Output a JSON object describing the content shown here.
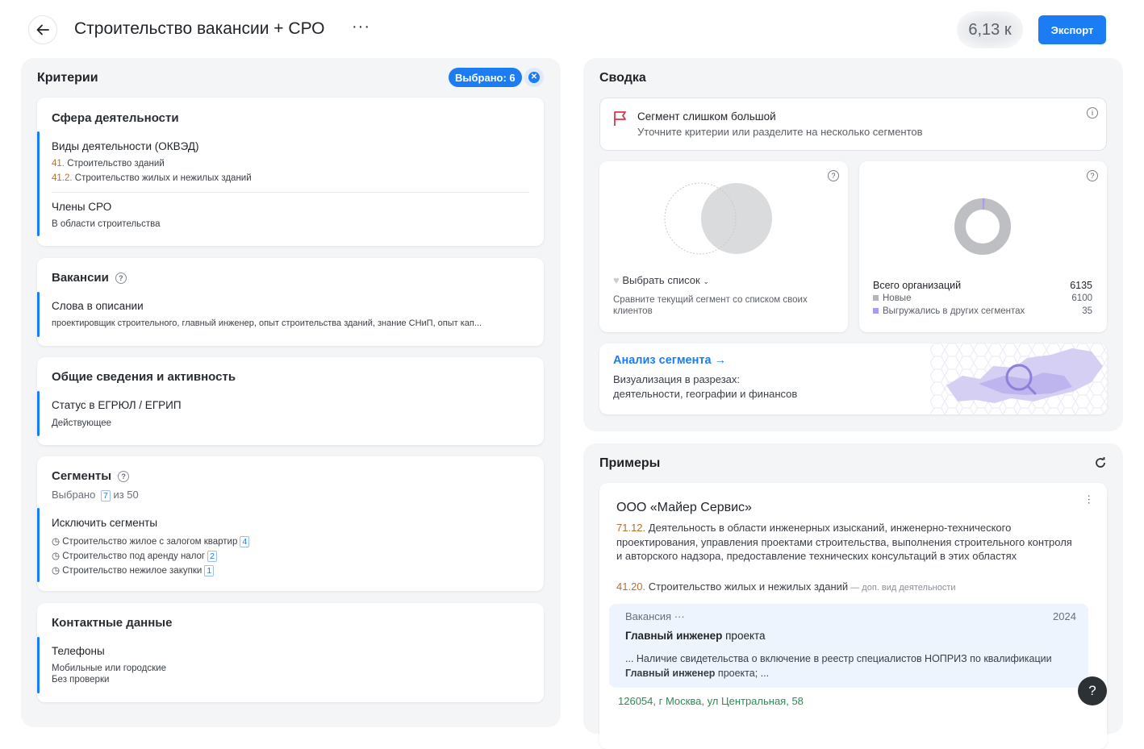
{
  "header": {
    "title": "Строительство вакансии + СРО",
    "more": "···",
    "count": "6,13 к",
    "export_label": "Экспорт"
  },
  "criteria": {
    "title": "Критерии",
    "selected_badge": "Выбрано: 6",
    "activity": {
      "title": "Сфера деятельности",
      "okved_title": "Виды деятельности (ОКВЭД)",
      "okved_items": [
        {
          "code": "41.",
          "text": " Строительство зданий"
        },
        {
          "code": "41.2.",
          "text": " Строительство жилых и нежилых зданий"
        }
      ],
      "sro_title": "Члены СРО",
      "sro_value": "В области строительства"
    },
    "vacancies": {
      "title": "Вакансии",
      "words_title": "Слова в описании",
      "words_value": "проектировщик строительного, главный инженер, опыт строительства зданий, знание СНиП, опыт кап..."
    },
    "general": {
      "title": "Общие сведения и активность",
      "status_title": "Статус в ЕГРЮЛ / ЕГРИП",
      "status_value": "Действующее"
    },
    "segments": {
      "title": "Сегменты",
      "selected_prefix": "Выбрано",
      "selected_count": "7",
      "selected_suffix": "из 50",
      "exclude_title": "Исключить сегменты",
      "items": [
        {
          "label": "Строительство жилое с залогом квартир",
          "count": "4"
        },
        {
          "label": "Строительство под аренду налог",
          "count": "2"
        },
        {
          "label": "Строительство нежилое закупки",
          "count": "1"
        }
      ]
    },
    "contacts": {
      "title": "Контактные данные",
      "phones_title": "Телефоны",
      "phones_line1": "Мобильные или городские",
      "phones_line2": "Без проверки"
    }
  },
  "summary": {
    "title": "Сводка",
    "warning_title": "Сегмент слишком большой",
    "warning_text": "Уточните критерии или разделите на несколько сегментов",
    "compare_label": "Выбрать список",
    "compare_hint": "Сравните текущий сегмент со списком своих клиентов",
    "orgs": [
      {
        "label": "Всего организаций",
        "value": "6135"
      },
      {
        "label": "Новые",
        "value": "6100",
        "color": "#b4b6b9"
      },
      {
        "label": "Выгружались в других сегментах",
        "value": "35",
        "color": "#a99cf0"
      }
    ],
    "analysis_title": "Анализ сегмента",
    "analysis_text1": "Визуализация в разрезах:",
    "analysis_text2": "деятельности, географии и финансов"
  },
  "examples": {
    "title": "Примеры",
    "company": "ООО «Майер Сервис»",
    "main_okved_code": "71.12.",
    "main_okved_text": " Деятельность в области инженерных изысканий, инженерно-технического проектирования, управления проектами строительства, выполнения строительного контроля и авторского надзора, предоставление технических консультаций в этих областях",
    "extra_okved_code": "41.20.",
    "extra_okved_text": " Строительство жилых и нежилых зданий",
    "extra_okved_note": " — доп. вид деятельности",
    "vacancy_label": "Вакансия",
    "vacancy_more": "···",
    "vacancy_year": "2024",
    "vacancy_title_bold": "Главный инженер",
    "vacancy_title_rest": " проекта",
    "vacancy_snippet_1": "... Наличие свидетельства о включение в реестр специалистов НОПРИЗ по квалификации ",
    "vacancy_snippet_bold": "Главный инженер",
    "vacancy_snippet_2": " проекта; ...",
    "address": "126054, г Москва,  ул Центральная, 58"
  },
  "colors": {
    "accent": "#1b7cf3",
    "warning_flag": "#d9364a",
    "code": "#b5702a",
    "address": "#2e8b57"
  }
}
